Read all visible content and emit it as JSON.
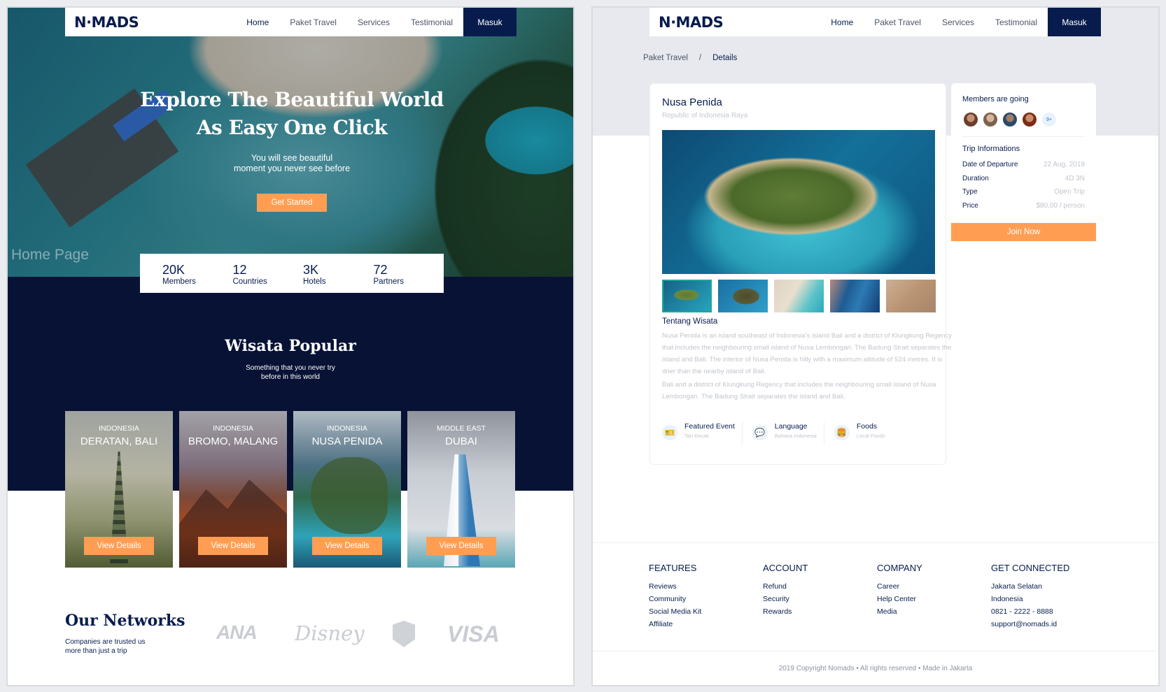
{
  "nav": {
    "logo": "N·MADS",
    "links": [
      "Home",
      "Paket Travel",
      "Services",
      "Testimonial"
    ],
    "cta": "Masuk"
  },
  "home": {
    "hero": {
      "title_line1": "Explore The Beautiful World",
      "title_line2": "As Easy One Click",
      "subtitle_line1": "You will see beautiful",
      "subtitle_line2": "moment you never see before",
      "button": "Get Started"
    },
    "page_label": "Home Page",
    "stats": [
      {
        "value": "20K",
        "label": "Members"
      },
      {
        "value": "12",
        "label": "Countries"
      },
      {
        "value": "3K",
        "label": "Hotels"
      },
      {
        "value": "72",
        "label": "Partners"
      }
    ],
    "popular": {
      "title": "Wisata Popular",
      "subtitle_line1": "Something that you never try",
      "subtitle_line2": "before in this world"
    },
    "destinations": [
      {
        "country": "INDONESIA",
        "name": "DERATAN, BALI",
        "button": "View Details"
      },
      {
        "country": "INDONESIA",
        "name": "BROMO, MALANG",
        "button": "View Details"
      },
      {
        "country": "INDONESIA",
        "name": "NUSA PENIDA",
        "button": "View Details"
      },
      {
        "country": "MIDDLE EAST",
        "name": "DUBAI",
        "button": "View Details"
      }
    ],
    "networks": {
      "title": "Our Networks",
      "subtitle_line1": "Companies are trusted us",
      "subtitle_line2": "more than just a trip",
      "partners": [
        "ANA",
        "Disney",
        "VISA"
      ]
    }
  },
  "detail": {
    "breadcrumb": [
      "Paket Travel",
      "/",
      "Details"
    ],
    "title": "Nusa Penida",
    "location": "Republic of Indonesia Raya",
    "about_title": "Tentang Wisata",
    "about_p1": "Nusa Penida is an island southeast of Indonesia's island Bali and a district of Klungkung Regency that includes the neighbouring small island of Nusa Lembongan. The Badung Strait separates the island and Bali. The interior of Nusa Penida is hilly with a maximum altitude of 524 metres. It is drier than the nearby island of Bali.",
    "about_p2": "Bali and a district of Klungkung Regency that includes the neighbouring small island of Nusa Lembongan. The Badung Strait separates the island and Bali.",
    "features": [
      {
        "icon": "ticket-icon",
        "glyph": "🎫",
        "title": "Featured Event",
        "sub": "Tari Kecak"
      },
      {
        "icon": "chat-icon",
        "glyph": "💬",
        "title": "Language",
        "sub": "Bahasa Indonesia"
      },
      {
        "icon": "burger-icon",
        "glyph": "🍔",
        "title": "Foods",
        "sub": "Local Foods"
      }
    ],
    "side": {
      "members_title": "Members are going",
      "more": "9+",
      "info_title": "Trip Informations",
      "rows": [
        {
          "key": "Date of Departure",
          "value": "22 Aug, 2019"
        },
        {
          "key": "Duration",
          "value": "4D 3N"
        },
        {
          "key": "Type",
          "value": "Open Trip"
        },
        {
          "key": "Price",
          "value": "$80,00 / person"
        }
      ],
      "button": "Join Now"
    },
    "footer": {
      "columns": [
        {
          "title": "FEATURES",
          "items": [
            "Reviews",
            "Community",
            "Social Media Kit",
            "Affiliate"
          ]
        },
        {
          "title": "ACCOUNT",
          "items": [
            "Refund",
            "Security",
            "Rewards"
          ]
        },
        {
          "title": "COMPANY",
          "items": [
            "Career",
            "Help Center",
            "Media"
          ]
        },
        {
          "title": "GET CONNECTED",
          "items": [
            "Jakarta Selatan",
            "Indonesia",
            "0821 - 2222 - 8888",
            "support@nomads.id"
          ]
        }
      ],
      "copyright": "2019 Copyright Nomads • All rights reserved • Made in Jakarta"
    }
  },
  "colors": {
    "navy": "#071c4d",
    "orange": "#ff9e53",
    "accent_blue": "#1b72d1"
  }
}
